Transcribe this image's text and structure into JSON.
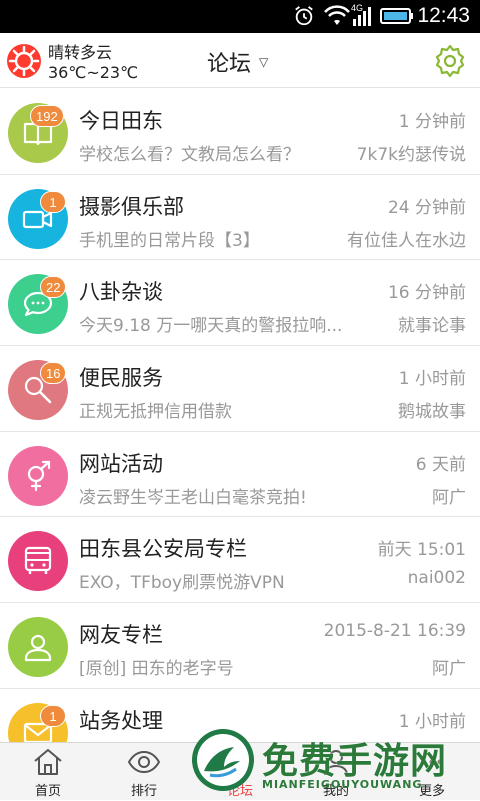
{
  "status_bar": {
    "time": "12:43",
    "network": "4G"
  },
  "header": {
    "weather_desc": "晴转多云",
    "weather_temp": "36℃~23℃",
    "title": "论坛",
    "title_caret": "▽"
  },
  "forums": [
    {
      "title": "今日田东",
      "subtitle": "学校怎么看？文教局怎么看？",
      "time": "1 分钟前",
      "author": "7k7k约瑟传说",
      "badge": "192",
      "color": "#a8c94a",
      "icon": "book-icon"
    },
    {
      "title": "摄影俱乐部",
      "subtitle": "手机里的日常片段【3】",
      "time": "24 分钟前",
      "author": "有位佳人在水边",
      "badge": "1",
      "color": "#18b4e0",
      "icon": "video-camera-icon"
    },
    {
      "title": "八卦杂谈",
      "subtitle": "今天9.18 万一哪天真的警报拉响...",
      "time": "16 分钟前",
      "author": "就事论事",
      "badge": "22",
      "color": "#3ccf8e",
      "icon": "chat-bubble-icon"
    },
    {
      "title": "便民服务",
      "subtitle": "正规无抵押信用借款",
      "time": "1 小时前",
      "author": "鹅城故事",
      "badge": "16",
      "color": "#e07880",
      "icon": "magnifier-icon"
    },
    {
      "title": "网站活动",
      "subtitle": "凌云野生岑王老山白毫茶竞拍!",
      "time": "6 天前",
      "author": "阿广",
      "badge": "",
      "color": "#f06ea0",
      "icon": "gender-icon"
    },
    {
      "title": "田东县公安局专栏",
      "subtitle": "EXO，TFboy刷票悦游VPN",
      "time": "前天 15:01",
      "author": "nai002",
      "badge": "",
      "color": "#e8407c",
      "icon": "bus-icon"
    },
    {
      "title": "网友专栏",
      "subtitle": "[原创] 田东的老字号",
      "time": "2015-8-21 16:39",
      "author": "阿广",
      "badge": "",
      "color": "#98cc44",
      "icon": "user-icon"
    },
    {
      "title": "站务处理",
      "subtitle": "",
      "time": "1 小时前",
      "author": "",
      "badge": "1",
      "color": "#f5c02a",
      "icon": "mail-icon"
    }
  ],
  "bottom_nav": [
    {
      "label": "首页",
      "icon": "home-icon"
    },
    {
      "label": "排行",
      "icon": "eye-icon"
    },
    {
      "label": "论坛",
      "icon": "forum-icon"
    },
    {
      "label": "我的",
      "icon": "profile-icon"
    },
    {
      "label": "更多",
      "icon": "more-icon"
    }
  ],
  "watermark": {
    "text": "免费手游网",
    "sub": "MIANFEIGOUYOUWANG"
  }
}
